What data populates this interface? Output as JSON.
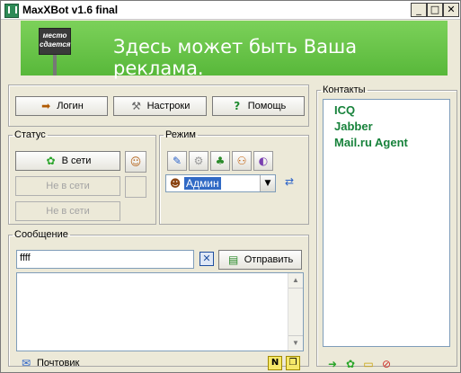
{
  "window": {
    "title": "MaxXBot v1.6 final",
    "min": "_",
    "max": "□",
    "close": "✕"
  },
  "banner": {
    "sign_line1": "место",
    "sign_line2": "сдается",
    "text": "Здесь может быть Ваша реклама."
  },
  "toolbar": {
    "login": "Логин",
    "settings": "Настроки",
    "help": "Помощь"
  },
  "status": {
    "legend": "Статус",
    "online": "В сети",
    "offline1": "Не в сети",
    "offline2": "Не в сети"
  },
  "mode": {
    "legend": "Режим",
    "selected": "Админ"
  },
  "message": {
    "legend": "Сообщение",
    "input_value": "ffff",
    "send": "Отправить",
    "mail": "Почтовик",
    "n_label": "N"
  },
  "contacts": {
    "legend": "Контакты",
    "items": [
      "ICQ",
      "Jabber",
      "Mail.ru Agent"
    ]
  },
  "colors": {
    "accent_green": "#17823b",
    "banner_green": "#58b83a"
  }
}
